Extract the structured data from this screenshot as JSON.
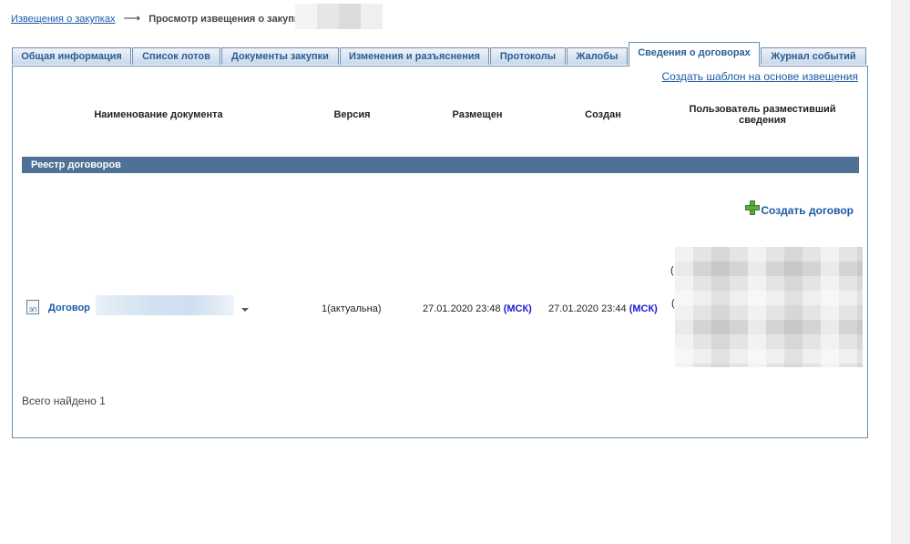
{
  "breadcrumb": {
    "root": "Извещения о закупках",
    "arrow": "⟶",
    "current": "Просмотр извещения о закупке"
  },
  "tabs": [
    "Общая информация",
    "Список лотов",
    "Документы закупки",
    "Изменения и разъяснения",
    "Протоколы",
    "Жалобы",
    "Сведения о договорах",
    "Журнал событий"
  ],
  "active_tab": "Сведения о договорах",
  "panel": {
    "template_link": "Создать шаблон на основе извещения",
    "columns": {
      "name": "Наименование документа",
      "version": "Версия",
      "placed": "Размещен",
      "created": "Создан",
      "user": "Пользователь разместивший сведения"
    },
    "section_title": "Реестр договоров",
    "create_contract": "Создать договор",
    "row": {
      "icon_label": "ЭП",
      "doc_name": "Договор",
      "version": "1(актуальна)",
      "placed_time": "27.01.2020 23:48",
      "created_time": "27.01.2020 23:44",
      "tz": "(МСК)",
      "user_mark_1": "(",
      "user_mark_2": "("
    },
    "total": "Всего найдено 1"
  },
  "colors": {
    "link": "#1a5aa8",
    "tab_border": "#6d8db5",
    "section_bar": "#4f7196",
    "tz": "#1b1bd1",
    "plus": "#5fa84a"
  },
  "icons": [
    "arrow-right-icon",
    "plus-icon",
    "signed-document-icon",
    "chevron-down-icon"
  ]
}
